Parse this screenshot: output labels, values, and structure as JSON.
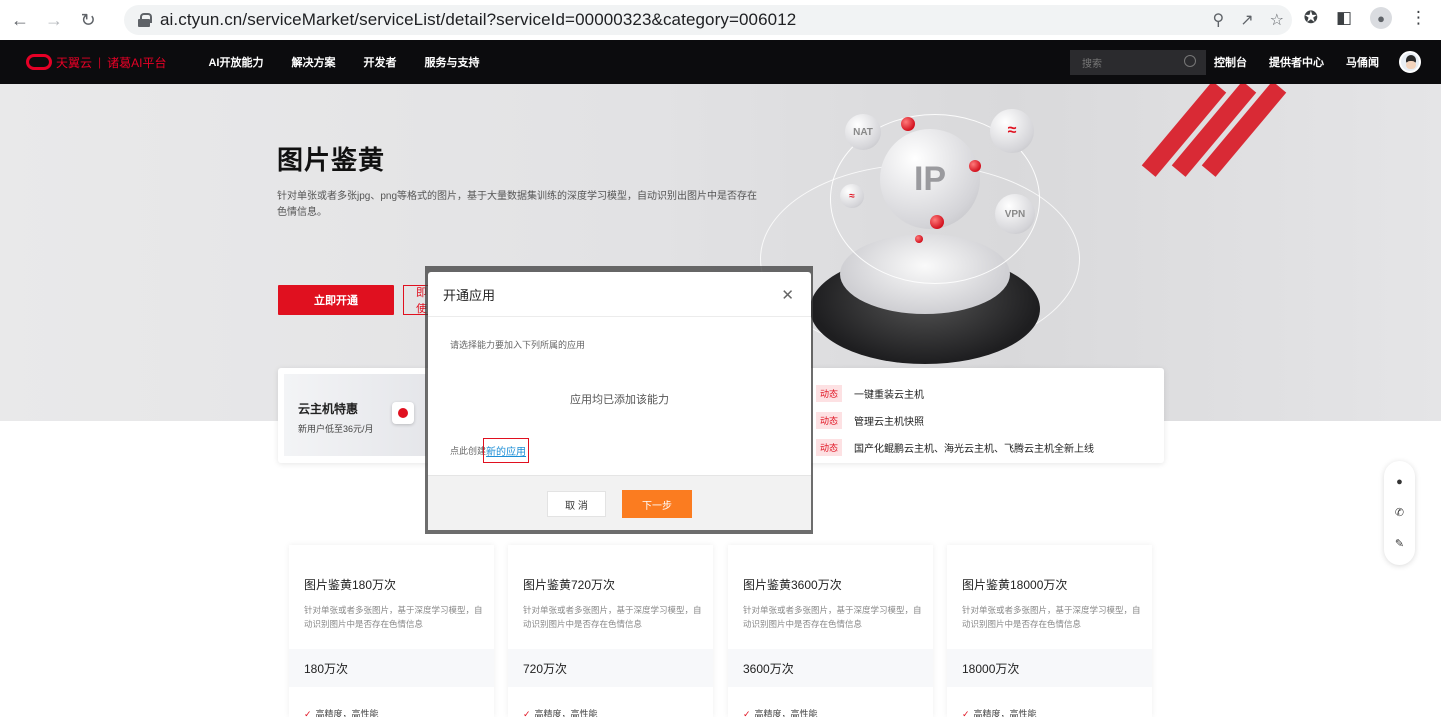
{
  "browser": {
    "url": "ai.ctyun.cn/serviceMarket/serviceList/detail?serviceId=00000323&category=006012"
  },
  "site_nav": {
    "brand": "天翼云",
    "platform": "诸葛AI平台",
    "menu": [
      "AI开放能力",
      "解决方案",
      "开发者",
      "服务与支持"
    ],
    "search_placeholder": "搜索",
    "console": "控制台",
    "provider_center": "提供者中心",
    "username": "马俑闻"
  },
  "hero": {
    "title": "图片鉴黄",
    "description": "针对单张或者多张jpg、png等格式的图片，基于大量数据集训练的深度学习模型，自动识别出图片中是否存在色情信息。",
    "primary_button": "立即开通",
    "secondary_button": "立即使用",
    "graphic_labels": [
      "NAT",
      "IP",
      "VPN"
    ]
  },
  "promo": {
    "card_title": "云主机特惠",
    "card_subtitle": "新用户低至36元/月",
    "news": [
      {
        "tag": "动态",
        "text": "一键重装云主机"
      },
      {
        "tag": "动态",
        "text": "管理云主机快照"
      },
      {
        "tag": "动态",
        "text": "国产化鲲鹏云主机、海光云主机、飞腾云主机全新上线"
      }
    ]
  },
  "products": [
    {
      "name": "图片鉴黄180万次",
      "desc": "针对单张或者多张图片，基于深度学习模型，自动识别图片中是否存在色情信息",
      "qty": "180万次",
      "feature": "高精度，高性能"
    },
    {
      "name": "图片鉴黄720万次",
      "desc": "针对单张或者多张图片，基于深度学习模型，自动识别图片中是否存在色情信息",
      "qty": "720万次",
      "feature": "高精度，高性能"
    },
    {
      "name": "图片鉴黄3600万次",
      "desc": "针对单张或者多张图片，基于深度学习模型，自动识别图片中是否存在色情信息",
      "qty": "3600万次",
      "feature": "高精度，高性能"
    },
    {
      "name": "图片鉴黄18000万次",
      "desc": "针对单张或者多张图片，基于深度学习模型，自动识别图片中是否存在色情信息",
      "qty": "18000万次",
      "feature": "高精度，高性能"
    }
  ],
  "modal": {
    "title": "开通应用",
    "tip": "请选择能力要加入下列所属的应用",
    "empty": "应用均已添加该能力",
    "create_prefix": "点此创建",
    "create_link": "新的应用",
    "cancel": "取 消",
    "next": "下一步"
  },
  "colors": {
    "brand_red": "#e0101f",
    "next_orange": "#fb7c20",
    "nav_bg": "#0c0c0e"
  }
}
